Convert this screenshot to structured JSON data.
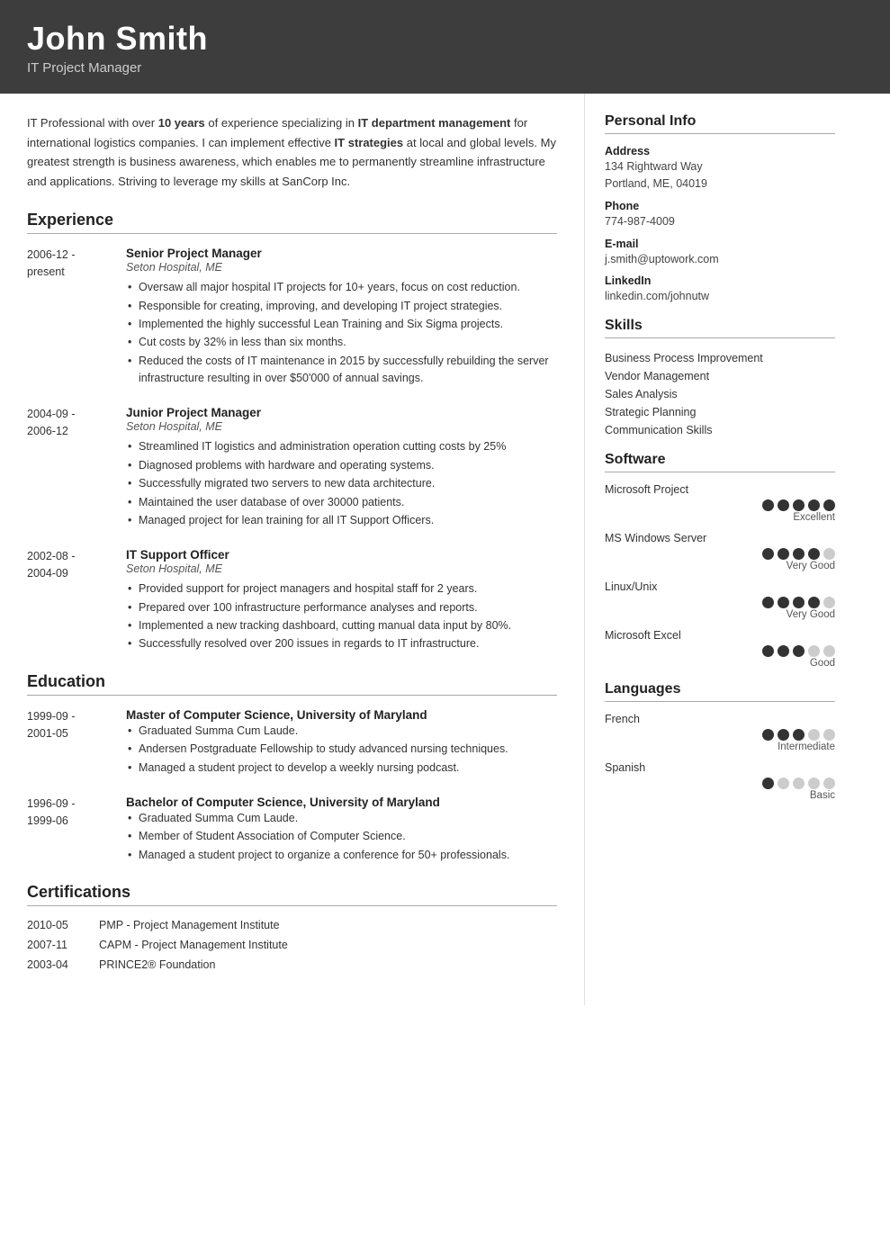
{
  "header": {
    "name": "John Smith",
    "title": "IT Project Manager"
  },
  "summary": {
    "text_parts": [
      "IT Professional with over ",
      "10 years",
      " of experience specializing in ",
      "IT department management",
      " for international logistics companies. I can implement effective ",
      "IT strategies",
      " at local and global levels. My greatest strength is business awareness, which enables me to permanently streamline infrastructure and applications. Striving to leverage my skills at SanCorp Inc."
    ]
  },
  "sections": {
    "experience_label": "Experience",
    "education_label": "Education",
    "certifications_label": "Certifications"
  },
  "experience": [
    {
      "dates": "2006-12 -\npresent",
      "title": "Senior Project Manager",
      "company": "Seton Hospital, ME",
      "bullets": [
        "Oversaw all major hospital IT projects for 10+ years, focus on cost reduction.",
        "Responsible for creating, improving, and developing IT project strategies.",
        "Implemented the highly successful Lean Training and Six Sigma projects.",
        "Cut costs by 32% in less than six months.",
        "Reduced the costs of IT maintenance in 2015 by successfully rebuilding the server infrastructure resulting in over $50'000 of annual savings."
      ]
    },
    {
      "dates": "2004-09 -\n2006-12",
      "title": "Junior Project Manager",
      "company": "Seton Hospital, ME",
      "bullets": [
        "Streamlined IT logistics and administration operation cutting costs by 25%",
        "Diagnosed problems with hardware and operating systems.",
        "Successfully migrated two servers to new data architecture.",
        "Maintained the user database of over 30000 patients.",
        "Managed project for lean training for all IT Support Officers."
      ]
    },
    {
      "dates": "2002-08 -\n2004-09",
      "title": "IT Support Officer",
      "company": "Seton Hospital, ME",
      "bullets": [
        "Provided support for project managers and hospital staff for 2 years.",
        "Prepared over 100 infrastructure performance analyses and reports.",
        "Implemented a new tracking dashboard, cutting manual data input by 80%.",
        "Successfully resolved over 200 issues in regards to IT infrastructure."
      ]
    }
  ],
  "education": [
    {
      "dates": "1999-09 -\n2001-05",
      "title": "Master of Computer Science, University of Maryland",
      "bullets": [
        "Graduated Summa Cum Laude.",
        "Andersen Postgraduate Fellowship to study advanced nursing techniques.",
        "Managed a student project to develop a weekly nursing podcast."
      ]
    },
    {
      "dates": "1996-09 -\n1999-06",
      "title": "Bachelor of Computer Science, University of Maryland",
      "bullets": [
        "Graduated Summa Cum Laude.",
        "Member of Student Association of Computer Science.",
        "Managed a student project to organize a conference for 50+ professionals."
      ]
    }
  ],
  "certifications": [
    {
      "date": "2010-05",
      "text": "PMP - Project Management Institute"
    },
    {
      "date": "2007-11",
      "text": "CAPM - Project Management Institute"
    },
    {
      "date": "2003-04",
      "text": "PRINCE2® Foundation"
    }
  ],
  "personal_info": {
    "label": "Personal Info",
    "address_label": "Address",
    "address_value": "134 Rightward Way\nPortland, ME, 04019",
    "phone_label": "Phone",
    "phone_value": "774-987-4009",
    "email_label": "E-mail",
    "email_value": "j.smith@uptowork.com",
    "linkedin_label": "LinkedIn",
    "linkedin_value": "linkedin.com/johnutw"
  },
  "skills": {
    "label": "Skills",
    "items": [
      "Business Process Improvement",
      "Vendor Management",
      "Sales Analysis",
      "Strategic Planning",
      "Communication Skills"
    ]
  },
  "software": {
    "label": "Software",
    "items": [
      {
        "name": "Microsoft Project",
        "filled": 5,
        "empty": 0,
        "rating": "Excellent"
      },
      {
        "name": "MS Windows Server",
        "filled": 4,
        "empty": 1,
        "rating": "Very Good"
      },
      {
        "name": "Linux/Unix",
        "filled": 4,
        "empty": 1,
        "rating": "Very Good"
      },
      {
        "name": "Microsoft Excel",
        "filled": 3,
        "empty": 2,
        "rating": "Good"
      }
    ]
  },
  "languages": {
    "label": "Languages",
    "items": [
      {
        "name": "French",
        "filled": 3,
        "empty": 2,
        "rating": "Intermediate"
      },
      {
        "name": "Spanish",
        "filled": 1,
        "empty": 4,
        "rating": "Basic"
      }
    ]
  }
}
